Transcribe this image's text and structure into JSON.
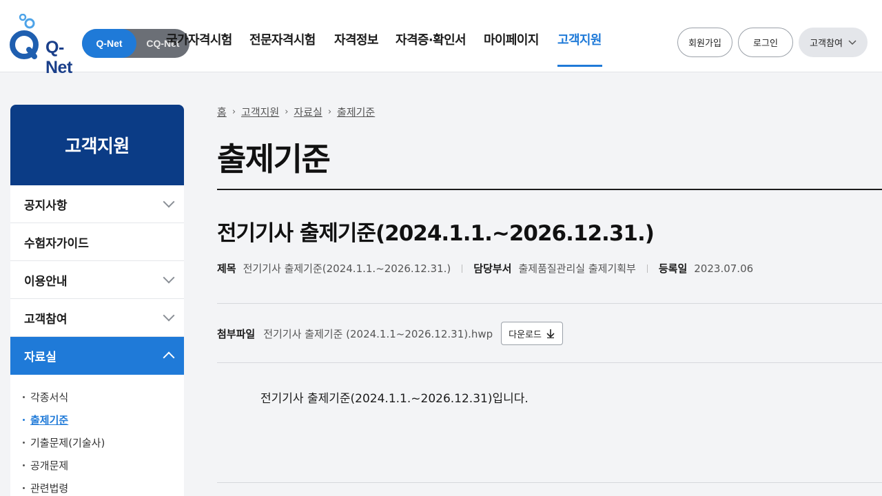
{
  "header": {
    "logo_text": "Q-Net",
    "toggle": {
      "active": "Q-Net",
      "inactive": "CQ-Net"
    },
    "nav": [
      {
        "label": "국가자격시험"
      },
      {
        "label": "전문자격시험"
      },
      {
        "label": "자격정보"
      },
      {
        "label": "자격증·확인서"
      },
      {
        "label": "마이페이지"
      },
      {
        "label": "고객지원",
        "active": true
      }
    ],
    "signup": "회원가입",
    "login": "로그인",
    "participate": "고객참여"
  },
  "sidebar": {
    "title": "고객지원",
    "items": [
      {
        "label": "공지사항",
        "expandable": true
      },
      {
        "label": "수험자가이드",
        "expandable": false
      },
      {
        "label": "이용안내",
        "expandable": true
      },
      {
        "label": "고객참여",
        "expandable": true
      },
      {
        "label": "자료실",
        "expanded": true
      }
    ],
    "subitems": [
      {
        "label": "각종서식"
      },
      {
        "label": "출제기준",
        "active": true
      },
      {
        "label": "기출문제(기술사)"
      },
      {
        "label": "공개문제"
      },
      {
        "label": "관련법령"
      }
    ]
  },
  "breadcrumb": [
    "홈",
    "고객지원",
    "자료실",
    "출제기준"
  ],
  "page_title": "출제기준",
  "post": {
    "title": "전기기사 출제기준(2024.1.1.~2026.12.31.)",
    "meta": {
      "subject_label": "제목",
      "subject_value": "전기기사 출제기준(2024.1.1.~2026.12.31.)",
      "dept_label": "담당부서",
      "dept_value": "출제품질관리실 출제기획부",
      "date_label": "등록일",
      "date_value": "2023.07.06"
    },
    "attachment": {
      "label": "첨부파일",
      "filename": "전기기사 출제기준 (2024.1.1~2026.12.31).hwp",
      "download": "다운로드"
    },
    "body": "전기기사 출제기준(2024.1.1.~2026.12.31)입니다."
  },
  "colors": {
    "brand_blue": "#1f7ad8",
    "navy": "#0b3c86"
  }
}
